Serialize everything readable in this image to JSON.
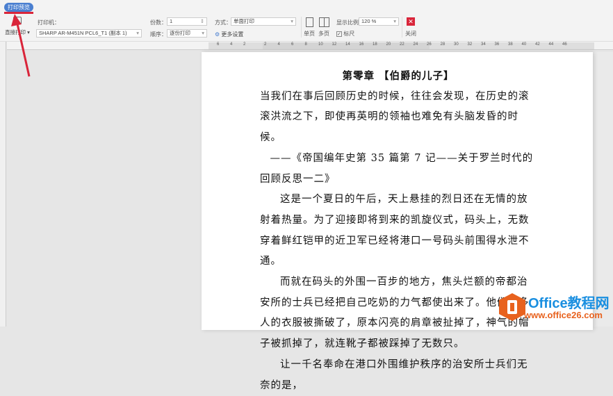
{
  "toolbar": {
    "tab": "打印预览",
    "direct_print": "直接打印",
    "printer_label": "打印机：",
    "printer_value": "SHARP AR-M451N PCL6_T1 (副本 1)",
    "copies_label": "份数：",
    "copies_value": "1",
    "order_label": "顺序：",
    "order_value": "逐份打印",
    "mode_label": "方式：",
    "mode_value": "单面打印",
    "more_settings": "更多设置",
    "single_page": "单页",
    "multi_page": "多页",
    "zoom_label": "显示比例",
    "zoom_value": "120 %",
    "ruler_label": "标尺",
    "ruler_checked": true,
    "close": "关闭"
  },
  "ruler": {
    "ticks": [
      "6",
      "4",
      "2",
      "2",
      "4",
      "6",
      "8",
      "10",
      "12",
      "14",
      "16",
      "18",
      "20",
      "22",
      "24",
      "26",
      "28",
      "30",
      "32",
      "34",
      "36",
      "38",
      "40",
      "42",
      "44",
      "46"
    ]
  },
  "document": {
    "title": "第零章 【伯爵的儿子】",
    "paragraphs": [
      "当我们在事后回顾历史的时候，往往会发现，在历史的滚滚洪流之下，即使再英明的领袖也难免有头脑发昏的时候。",
      "——《帝国编年史第 35 篇第 7 记——关于罗兰时代的回顾反思一二》",
      "这是一个夏日的午后，天上悬挂的烈日还在无情的放射着热量。为了迎接即将到来的凯旋仪式，码头上，无数穿着鲜红铠甲的近卫军已经将港口一号码头前围得水泄不通。",
      "而就在码头的外围一百步的地方，焦头烂额的帝都治安所的士兵已经把自己吃奶的力气都使出来了。他们很多人的衣服被撕破了，原本闪亮的肩章被扯掉了，神气的帽子被抓掉了，就连靴子都被踩掉了无数只。",
      "让一千名奉命在港口外围维护秩序的治安所士兵们无奈的是，"
    ]
  },
  "watermark": {
    "brand": "Office教程网",
    "url": "www.office26.com"
  }
}
